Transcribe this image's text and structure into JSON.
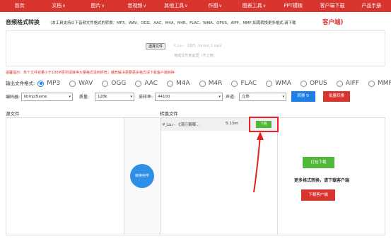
{
  "nav": {
    "items": [
      {
        "label": "首页",
        "chevron": false
      },
      {
        "label": "文档",
        "chevron": true
      },
      {
        "label": "图片",
        "chevron": true
      },
      {
        "label": "音视频",
        "chevron": true
      },
      {
        "label": "其他工具",
        "chevron": true
      },
      {
        "label": "作图",
        "chevron": true
      },
      {
        "label": "图表工具",
        "chevron": true
      },
      {
        "label": "PPT模板",
        "chevron": false
      },
      {
        "label": "客户端下载",
        "chevron": false
      },
      {
        "label": "产品手册",
        "chevron": false
      }
    ],
    "chevron_glyph": "∨"
  },
  "page": {
    "title": "音频格式转换",
    "description": "（本工具支持以下音频文件格式的转换：MP3、WAV、OGG、AAC、M4A、M4R、FLAC、WMA、OPUS、AIFF、MMF,如需转换更多格式,请下载",
    "description_link": "客户端)"
  },
  "upload": {
    "choose_button": "选择文件",
    "chosen_file": "P_Liu - 《流行...format_1.mp3",
    "drop_hint": "拖动文件到此里（不上传）"
  },
  "warning": "温馨提示：单个文件容量小于100M否则请转换大量格式请到终荐，播荐解决更要更多格式请下载客户端转换",
  "output_format": {
    "label": "输出文件格式:",
    "options": [
      "MP3",
      "WAV",
      "OGG",
      "AAC",
      "M4A",
      "M4R",
      "FLAC",
      "WMA",
      "OPUS",
      "AIFF",
      "MMF"
    ],
    "selected": "MP3"
  },
  "settings": {
    "encoder_label": "编码器:",
    "encoder_value": "libmp3lame",
    "quality_label": "质量:",
    "quality_value": "128k",
    "samplerate_label": "采样率:",
    "samplerate_value": "44100",
    "channel_label": "声道:",
    "channel_value": "立体",
    "arrow_glyph": "▾",
    "convert_button": "转换 ↻",
    "batch_button": "批量转换"
  },
  "panels": {
    "source_label": "源文件",
    "output_label": "转换文件",
    "convert_done": "转换完毕"
  },
  "output_file": {
    "name": "P_Liu - 《流行钢琴...",
    "size": "5.13m",
    "download": "下载"
  },
  "right_panel": {
    "pack_download": "打包下载",
    "more_text": "更多格式转换，请下载客户端",
    "download_client": "下载客户端"
  },
  "colors": {
    "brand_red": "#d9352f",
    "accent_blue": "#1d7ee6",
    "success_green": "#52b83a",
    "highlight_red": "#e22222"
  }
}
